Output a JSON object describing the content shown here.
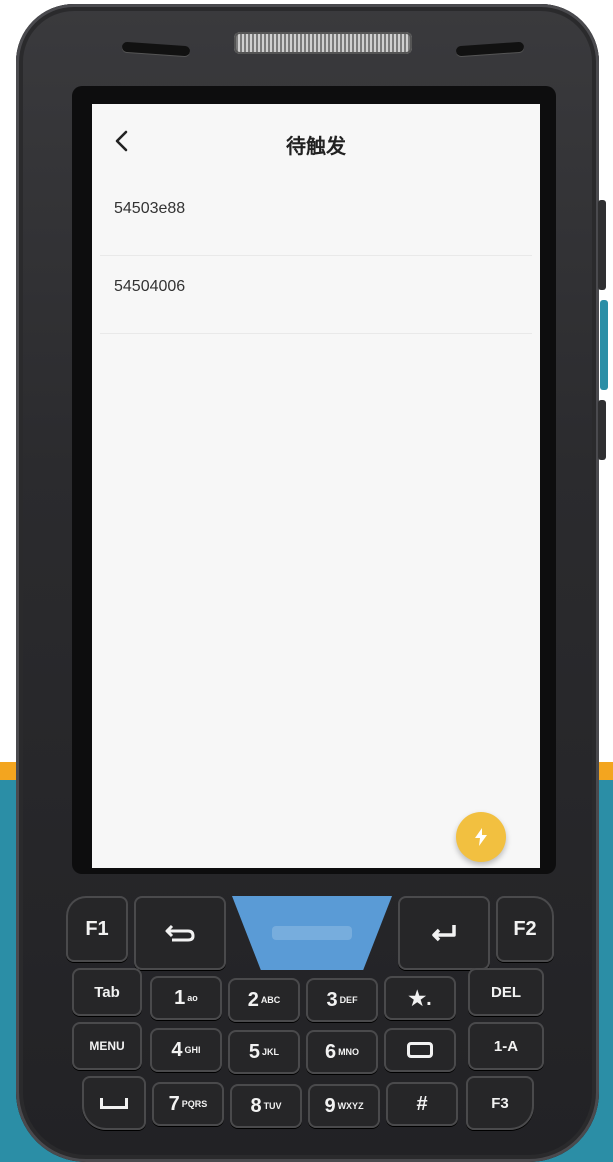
{
  "header": {
    "title": "待触发"
  },
  "list": {
    "items": [
      {
        "label": "54503e88"
      },
      {
        "label": "54504006"
      }
    ]
  },
  "fab": {
    "icon": "lightning-icon",
    "color": "#f2c040"
  },
  "keypad": {
    "f1": "F1",
    "f2": "F2",
    "f3": "F3",
    "tab": "Tab",
    "menu": "MENU",
    "del": "DEL",
    "one_a": "1-A",
    "k1": "1",
    "k1_sub": "ao",
    "k2": "2",
    "k2_sub": "ABC",
    "k3": "3",
    "k3_sub": "DEF",
    "k4": "4",
    "k4_sub": "GHI",
    "k5": "5",
    "k5_sub": "JKL",
    "k6": "6",
    "k6_sub": "MNO",
    "k7": "7",
    "k7_sub": "PQRS",
    "k8": "8",
    "k8_sub": "TUV",
    "k9": "9",
    "k9_sub": "WXYZ",
    "star": "★.",
    "hash": "#"
  },
  "colors": {
    "teal": "#2b8ea6",
    "orange": "#f3a51f",
    "scan_blue": "#5a9bd6"
  }
}
